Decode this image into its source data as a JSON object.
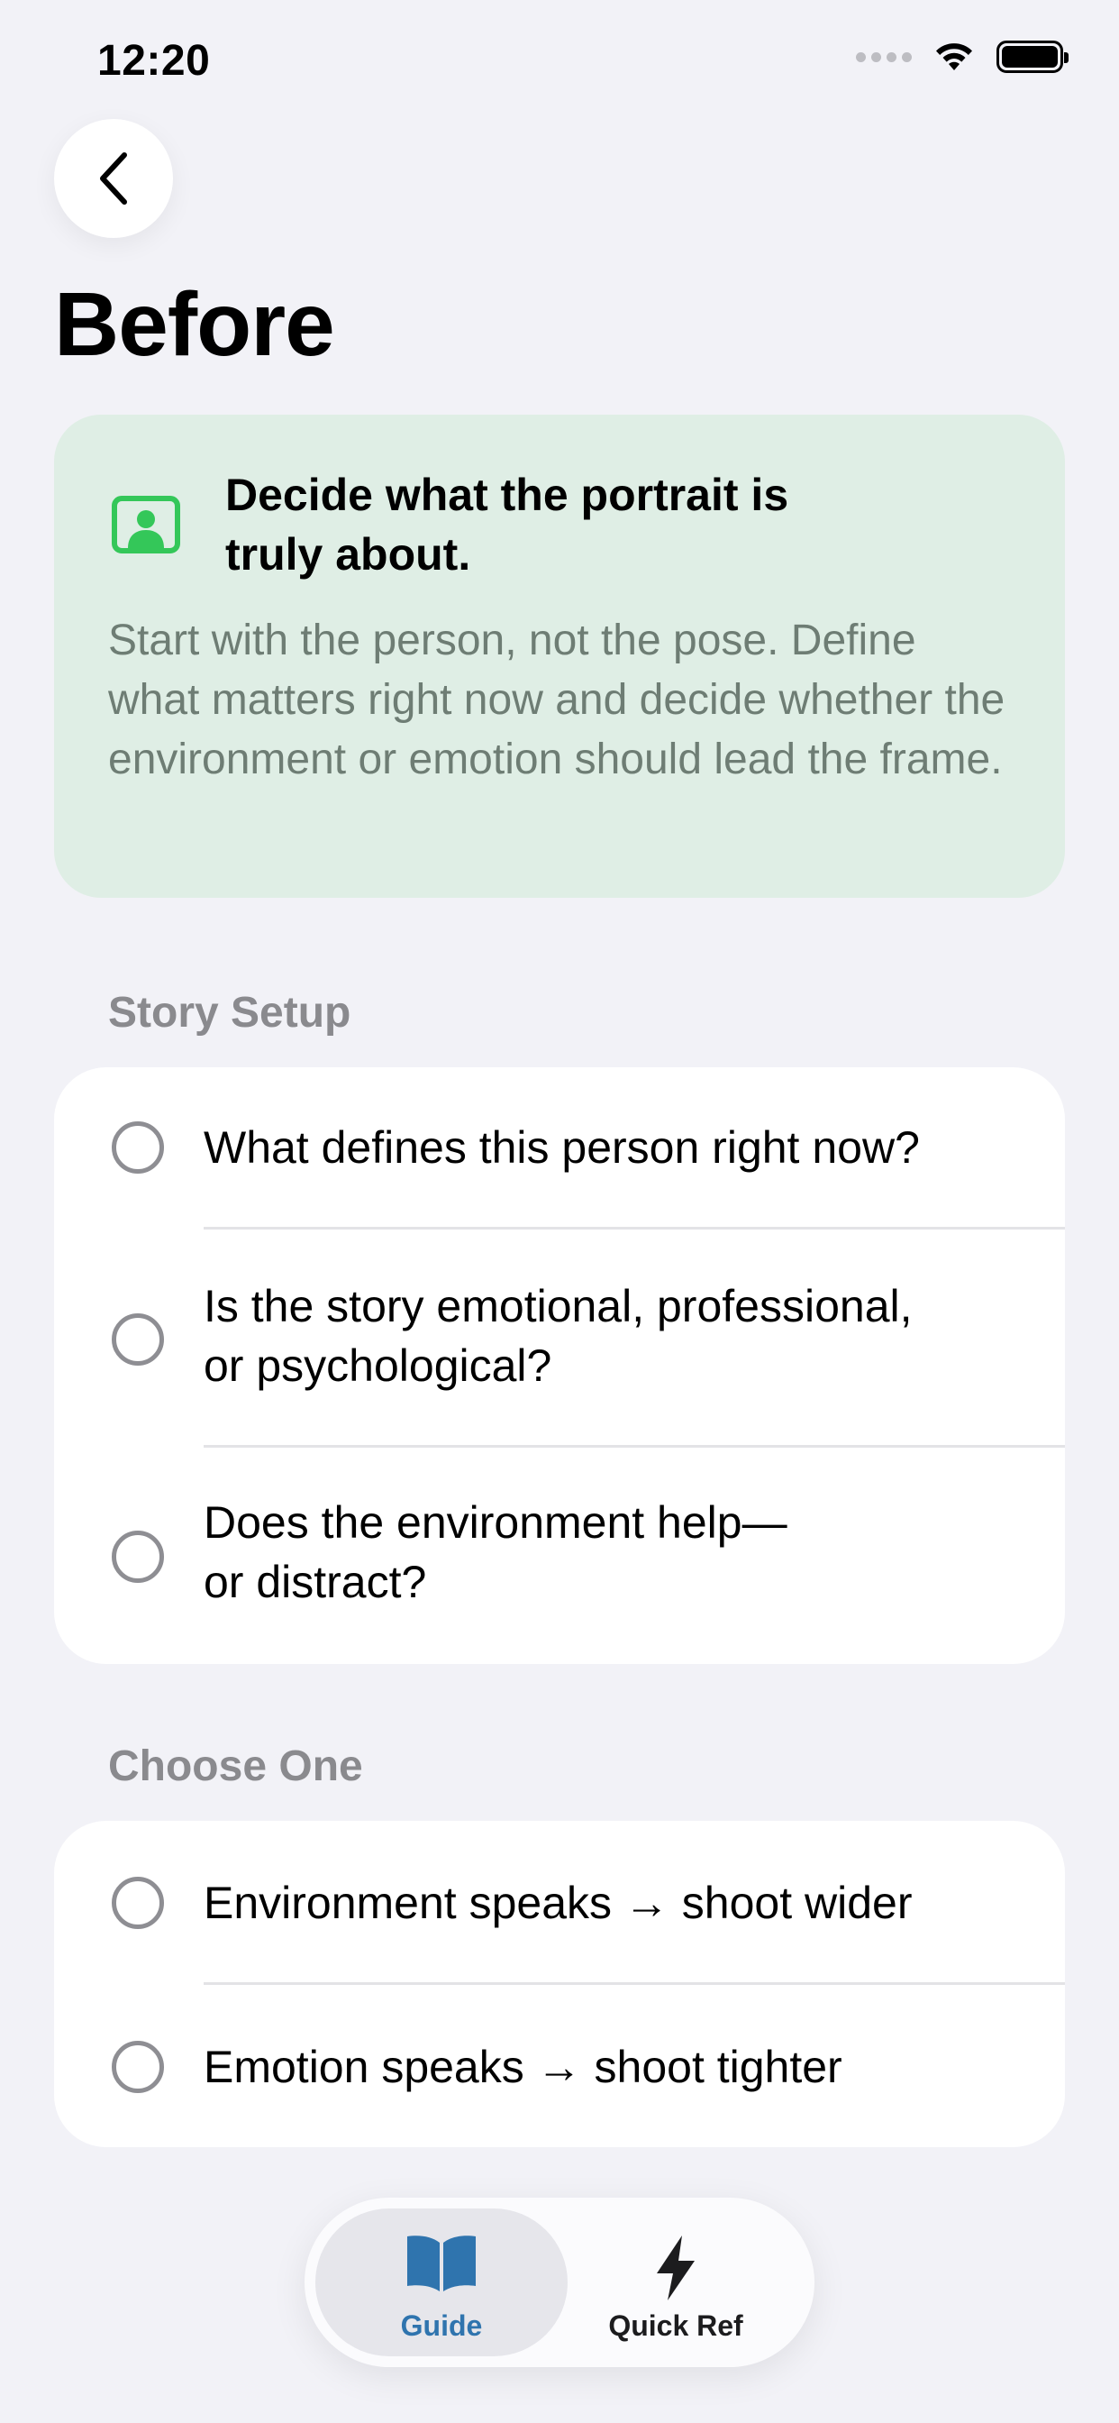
{
  "status_bar": {
    "time": "12:20"
  },
  "header": {
    "back_icon": "chevron-left-icon",
    "title": "Before"
  },
  "intro": {
    "icon": "portrait-icon",
    "heading": "Decide what the portrait is truly about.",
    "body": "Start with the person, not the pose. Define what matters right now and decide whether the environment or emotion should lead the frame.",
    "background_color": "#DFEEE5",
    "accent_color": "#34C759"
  },
  "sections": [
    {
      "title": "Story Setup",
      "items": [
        {
          "label": "What defines this person right now?",
          "checked": false
        },
        {
          "label": "Is the story emotional, professional, or psychological?",
          "checked": false
        },
        {
          "label": "Does the environment help—\nor distract?",
          "checked": false
        }
      ]
    },
    {
      "title": "Choose One",
      "items": [
        {
          "label": "Environment speaks → shoot wider",
          "checked": false
        },
        {
          "label": "Emotion speaks → shoot tighter",
          "checked": false
        }
      ]
    }
  ],
  "tab_bar": {
    "tabs": [
      {
        "label": "Guide",
        "icon": "book-open-icon",
        "selected": true
      },
      {
        "label": "Quick Ref",
        "icon": "lightning-bolt-icon",
        "selected": false
      }
    ],
    "selected_color": "#2F74AE"
  }
}
